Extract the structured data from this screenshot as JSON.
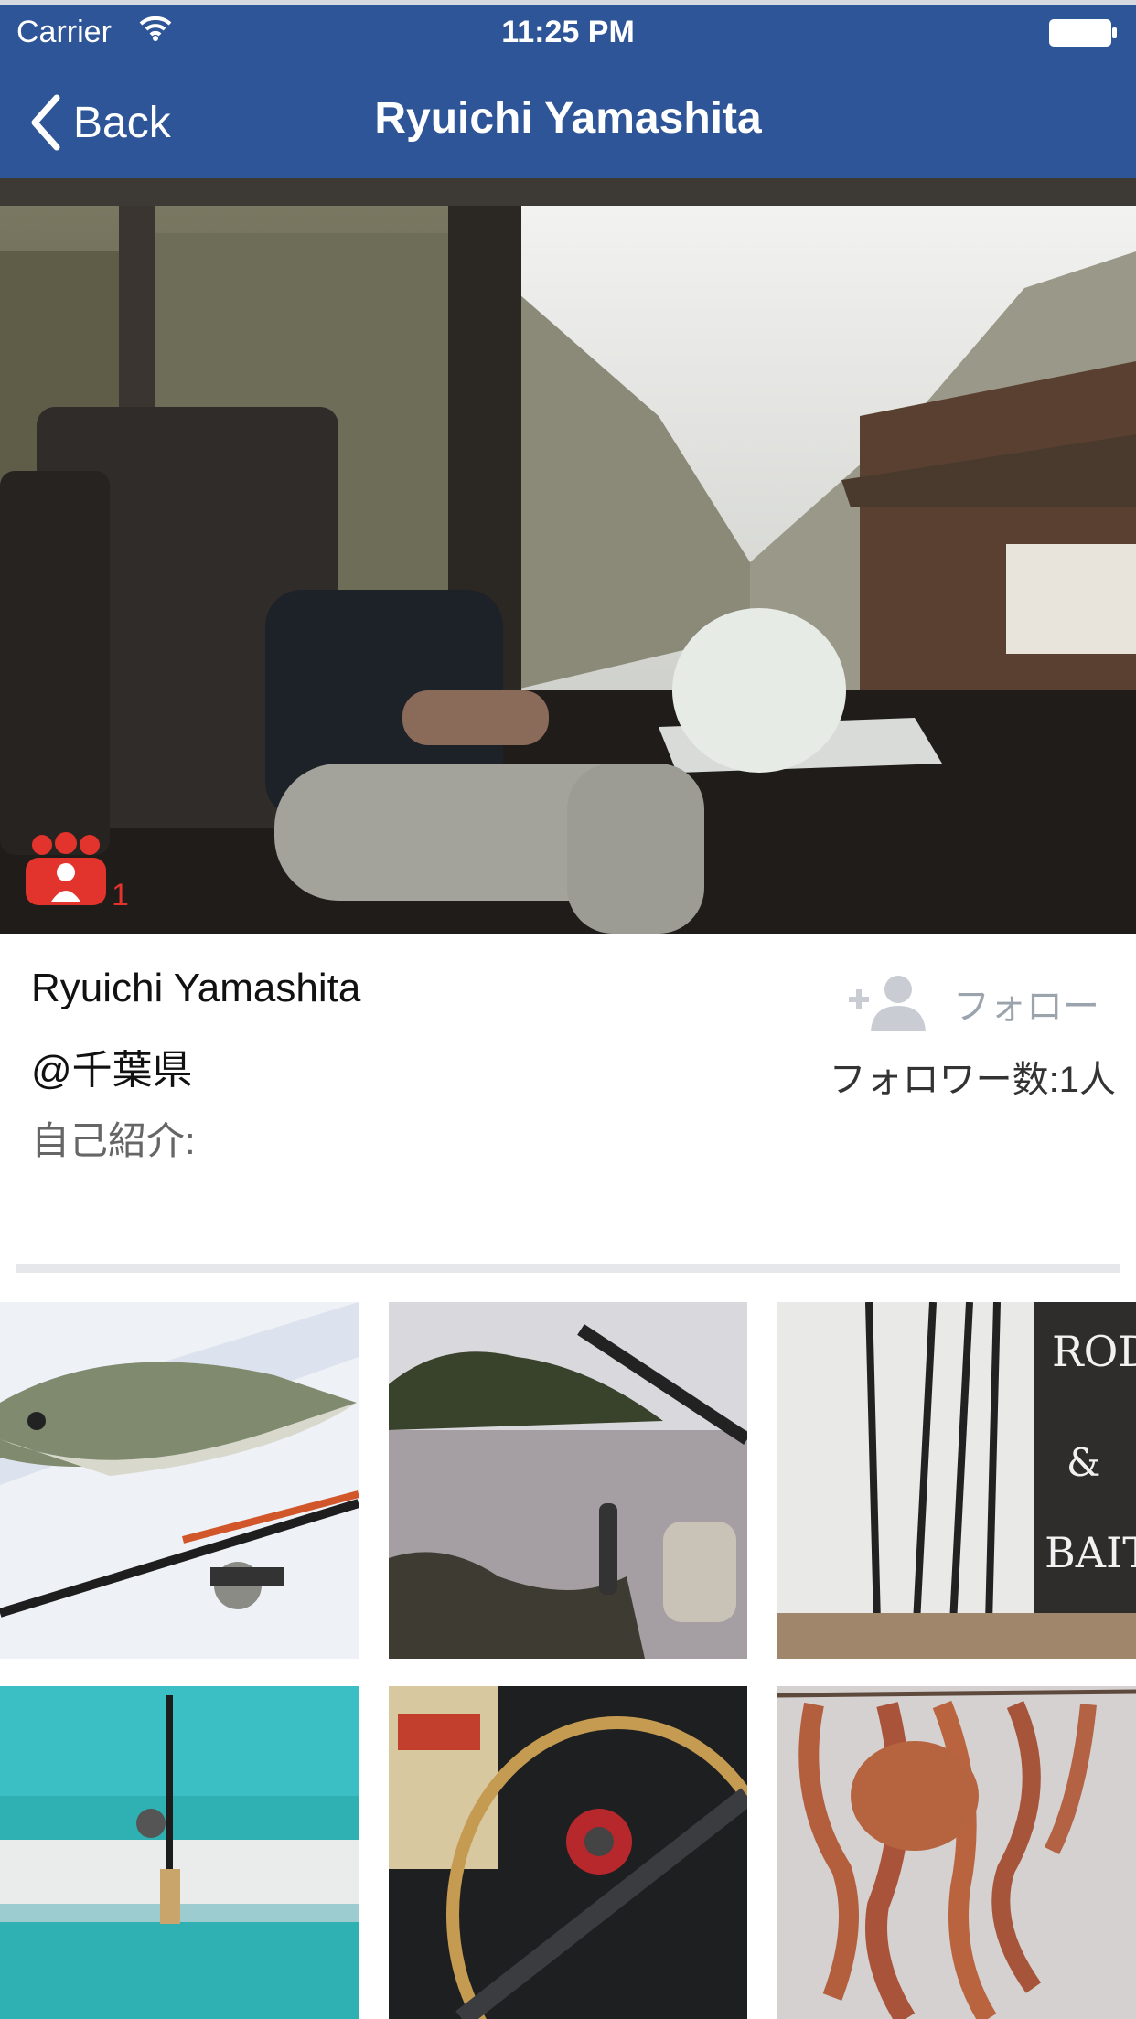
{
  "status_bar": {
    "carrier": "Carrier",
    "time": "11:25 PM"
  },
  "nav": {
    "back_label": "Back",
    "title": "Ryuichi Yamashita"
  },
  "hero": {
    "group_count": "1"
  },
  "profile": {
    "name": "Ryuichi Yamashita",
    "location": "@千葉県",
    "bio_label": "自己紹介:",
    "follow_label": "フォロー",
    "followers_text": "フォロワー数:1人"
  },
  "colors": {
    "nav_bg": "#2e5597",
    "badge": "#e2342c",
    "follow_gray": "#9ba3ad"
  },
  "icons": [
    "wifi-icon",
    "battery-icon",
    "back-chevron-icon",
    "group-icon",
    "add-person-icon"
  ]
}
